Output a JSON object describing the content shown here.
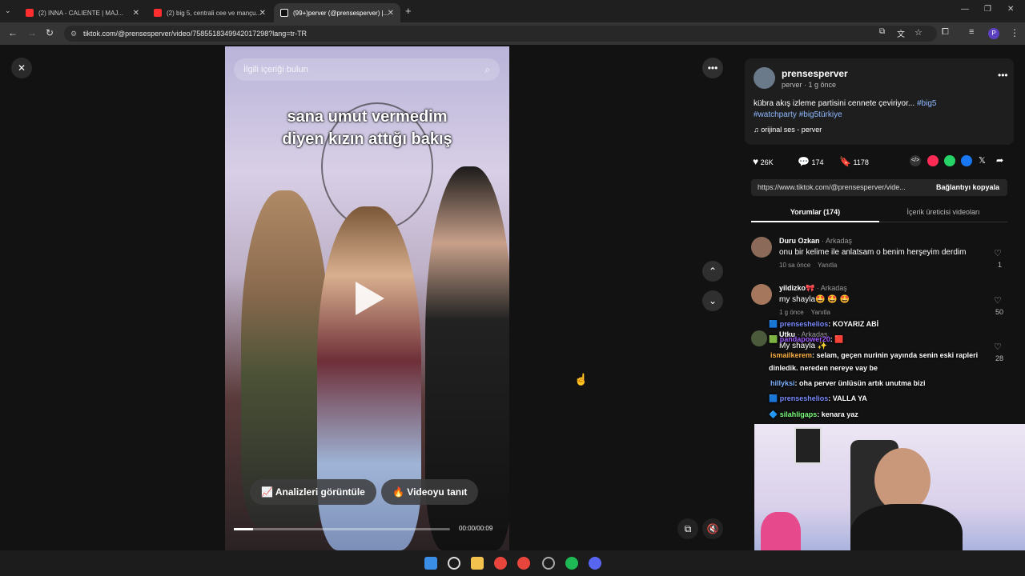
{
  "browser": {
    "tabs": [
      {
        "title": "(2) INNA - CALIENTE | MAJ..."
      },
      {
        "title": "(2) big 5, centrali cee ve mançu..."
      },
      {
        "title": "(99+)perver (@prensesperver) |..."
      }
    ],
    "url": "tiktok.com/@prensesperver/video/7585518349942017298?lang=tr-TR",
    "profile_initial": "P"
  },
  "video": {
    "search_placeholder": "İlgili içeriği bulun",
    "caption_line1": "sana umut vermedim",
    "caption_line2": "diyen kızın attığı bakış",
    "analytics_button": "Analizleri görüntüle",
    "promote_button": "Videoyu tanıt",
    "time": "00:00/00:09",
    "progress": 0.09
  },
  "post": {
    "username": "prensesperver",
    "subline": "perver · 1 g önce",
    "description": "kübra akış izleme partisini cennete çeviriyor...",
    "hashtags": [
      "#big5",
      "#watchparty",
      "#big5türkiye"
    ],
    "sound": "orijinal ses - perver",
    "likes": "26K",
    "comments": "174",
    "saves": "1178",
    "link": "https://www.tiktok.com/@prensesperver/vide...",
    "copy_link": "Bağlantıyı kopyala",
    "tab_comments": "Yorumlar (174)",
    "tab_creator": "İçerik üreticisi videoları"
  },
  "comments": [
    {
      "name": "Duru Ozkan",
      "tag": "· Arkadaş",
      "text": "onu bir kelime ile anlatsam o benim herşeyim derdim",
      "time": "10 sa önce",
      "reply": "Yanıtla",
      "likes": "1"
    },
    {
      "name": "yildizko🎀",
      "tag": "· Arkadaş",
      "text": "my shayla🤩 🤩 🤩",
      "time": "1 g önce",
      "reply": "Yanıtla",
      "likes": "50"
    },
    {
      "name": "Utku",
      "tag": "· Arkadaş",
      "text": "My shayla ✨",
      "time": "",
      "reply": "",
      "likes": "28"
    }
  ],
  "chat": [
    {
      "user": "prenseshelios",
      "msg": ": KOYARIZ ABİ",
      "color": "#7b8cff"
    },
    {
      "user": "pandapower20",
      "msg": ": 🟥",
      "color": "#a05cff"
    },
    {
      "user": "ismailkerem",
      "msg": ": selam, geçen nurinin yayında senin eski rapleri",
      "color": "#ffb347"
    },
    {
      "user": "",
      "msg": "dinledik. nereden nereye vay be",
      "color": "#ffffff"
    },
    {
      "user": "hillyksi",
      "msg": ": oha perver ünlüsün artık unutma bizi",
      "color": "#7fb2ff"
    },
    {
      "user": "prenseshelios",
      "msg": ": VALLA YA",
      "color": "#7b8cff"
    },
    {
      "user": "silahligaps",
      "msg": ": kenara yaz",
      "color": "#7dff7d"
    }
  ],
  "colors": {
    "accent": "#fe2c55",
    "hashtag": "#8fb8ff",
    "panel_bg": "#121212"
  }
}
